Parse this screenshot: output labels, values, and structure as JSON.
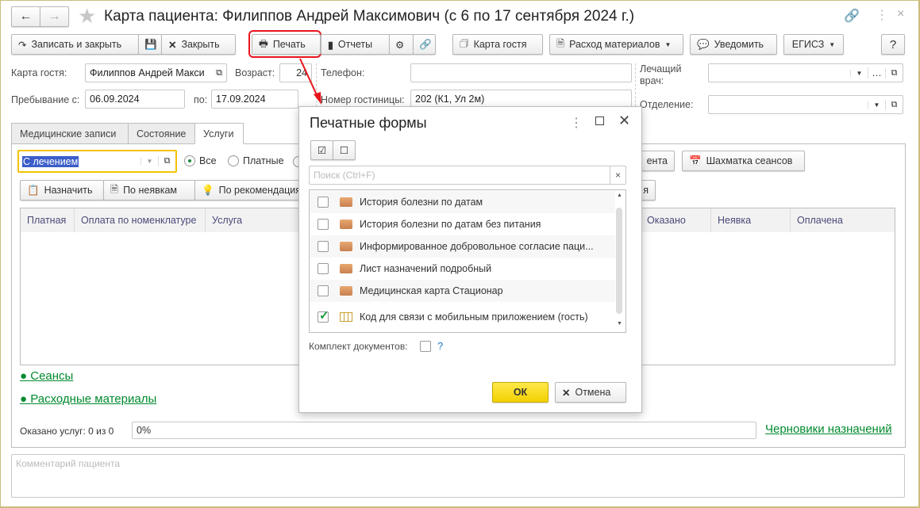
{
  "window": {
    "title": "Карта пациента: Филиппов Андрей Максимович (с 6 по 17 сентября 2024 г.)"
  },
  "toolbar": {
    "save_close": "Записать и закрыть",
    "close": "Закрыть",
    "print": "Печать",
    "reports": "Отчеты",
    "guest_card": "Карта гостя",
    "materials": "Расход материалов",
    "notify": "Уведомить",
    "egisz": "ЕГИСЗ",
    "help": "?"
  },
  "form": {
    "guest_card_label": "Карта гостя:",
    "guest_card_value": "Филиппов Андрей Макси",
    "age_label": "Возраст:",
    "age_value": "24",
    "phone_label": "Телефон:",
    "phone_value": "",
    "doctor_label": "Лечащий врач:",
    "stay_from_label": "Пребывание с:",
    "stay_from": "06.09.2024",
    "stay_to_label": "по:",
    "stay_to": "17.09.2024",
    "room_label": "Номер гостиницы:",
    "room_value": "202 (К1, Ул 2м)",
    "department_label": "Отделение:"
  },
  "tabs": [
    "Медицинские записи",
    "Состояние",
    "Услуги"
  ],
  "services": {
    "filter_value": "С лечением",
    "radio_all": "Все",
    "radio_paid": "Платные",
    "btn_partial": "ента",
    "btn_chess": "Шахматка сеансов",
    "btn_assign": "Назначить",
    "btn_noshow": "По неявкам",
    "btn_recommend": "По рекомендация",
    "btn_partial2": "я",
    "columns": [
      "Платная",
      "Оплата по номенклатуре",
      "Услуга",
      "Оказано",
      "Неявка",
      "Оплачена"
    ],
    "link_sessions": "Сеансы",
    "link_materials": "Расходные материалы",
    "provided_label": "Оказано услуг: 0 из 0",
    "progress_text": "0%",
    "progress": 0,
    "link_drafts": "Черновики назначений"
  },
  "comment_placeholder": "Комментарий пациента",
  "dialog": {
    "title": "Печатные формы",
    "search_placeholder": "Поиск (Ctrl+F)",
    "items": [
      {
        "label": "История болезни по датам",
        "checked": false
      },
      {
        "label": "История болезни по датам без питания",
        "checked": false
      },
      {
        "label": "Информированное добровольное согласие паци...",
        "checked": false
      },
      {
        "label": "Лист назначений подробный",
        "checked": false
      },
      {
        "label": "Медицинская карта Стационар",
        "checked": false
      },
      {
        "label": "Код для связи с мобильным приложением (гость)",
        "checked": true
      }
    ],
    "kit_label": "Комплект документов:",
    "kit_help": "?",
    "ok": "ОК",
    "cancel": "Отмена"
  }
}
